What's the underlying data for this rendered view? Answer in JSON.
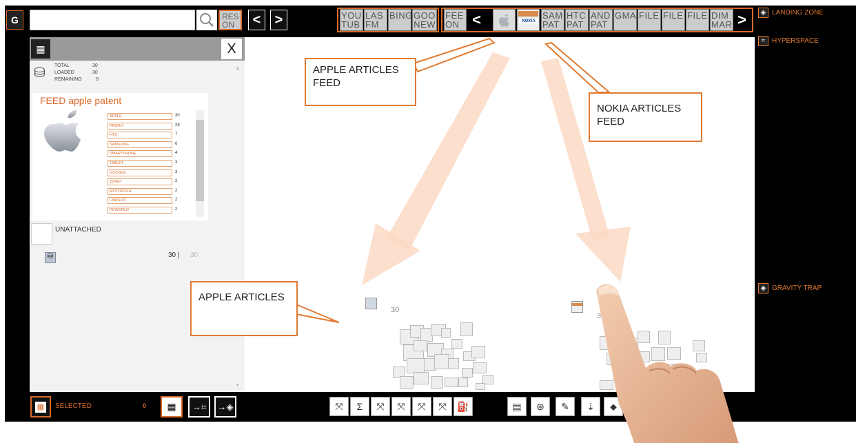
{
  "topbar": {
    "logo_icon": "g-logo-icon",
    "search_value": "",
    "search_button_icon": "search-icon",
    "reset_label_1": "RES",
    "reset_label_2": "ON",
    "tabs_group1": [
      {
        "l1": "YOU",
        "l2": "TUB"
      },
      {
        "l1": "LAS",
        "l2": "FM"
      },
      {
        "l1": "BING",
        "l2": ""
      },
      {
        "l1": "GOO",
        "l2": "NEW"
      }
    ],
    "tabs_group2_first": {
      "l1": "FEE",
      "l2": "ON"
    },
    "tabs_group2": [
      {
        "l1": "SAM",
        "l2": "PAT"
      },
      {
        "l1": "HTC",
        "l2": "PAT"
      },
      {
        "l1": "AND",
        "l2": "PAT"
      },
      {
        "l1": "GMA",
        "l2": ""
      },
      {
        "l1": "FILE",
        "l2": ""
      },
      {
        "l1": "FILE",
        "l2": ""
      },
      {
        "l1": "FILE",
        "l2": ""
      },
      {
        "l1": "DIM",
        "l2": "MAR"
      }
    ],
    "nokia_label": "NOKIA"
  },
  "rightpanel": {
    "landing_zone": "LANDING ZONE",
    "hyperspace": "HYPERSPACE",
    "gravity_trap": "GRAVITY TRAP"
  },
  "leftpanel": {
    "close_label": "X",
    "stats": {
      "total_label": "TOTAL",
      "total_value": "30",
      "loaded_label": "LOADED",
      "loaded_value": "30",
      "remaining_label": "REMAINING",
      "remaining_value": "0"
    },
    "feed_title": "FEED apple patent",
    "tags": [
      {
        "name": "APPLE",
        "count": "30"
      },
      {
        "name": "PATENT",
        "count": "28"
      },
      {
        "name": "HTC",
        "count": "7"
      },
      {
        "name": "SAMSUNG",
        "count": "6"
      },
      {
        "name": "SMARTPHONE",
        "count": "4"
      },
      {
        "name": "TABLET",
        "count": "3"
      },
      {
        "name": "GOOGLE",
        "count": "3"
      },
      {
        "name": "ZDNET",
        "count": "2"
      },
      {
        "name": "MOTOROLA",
        "count": "2"
      },
      {
        "name": "LAWSUIT",
        "count": "2"
      },
      {
        "name": "PCWORLD",
        "count": "2"
      }
    ],
    "unattached_label": "UNATTACHED",
    "count_primary": "30 |",
    "count_secondary": "30"
  },
  "canvas": {
    "apple_cluster_count": "30",
    "nokia_cluster_count": "30"
  },
  "callouts": {
    "apple_feed_l1": "APPLE ARTICLES",
    "apple_feed_l2": "FEED",
    "nokia_feed_l1": "NOKIA ARTICLES",
    "nokia_feed_l2": "FEED",
    "apple_articles": "APPLE ARTICLES"
  },
  "bottombar": {
    "selected_label": "SELECTED",
    "selected_count": "0"
  },
  "colors": {
    "accent": "#e07a30",
    "frame": "#000000",
    "arrow": "#fbd9c4"
  }
}
